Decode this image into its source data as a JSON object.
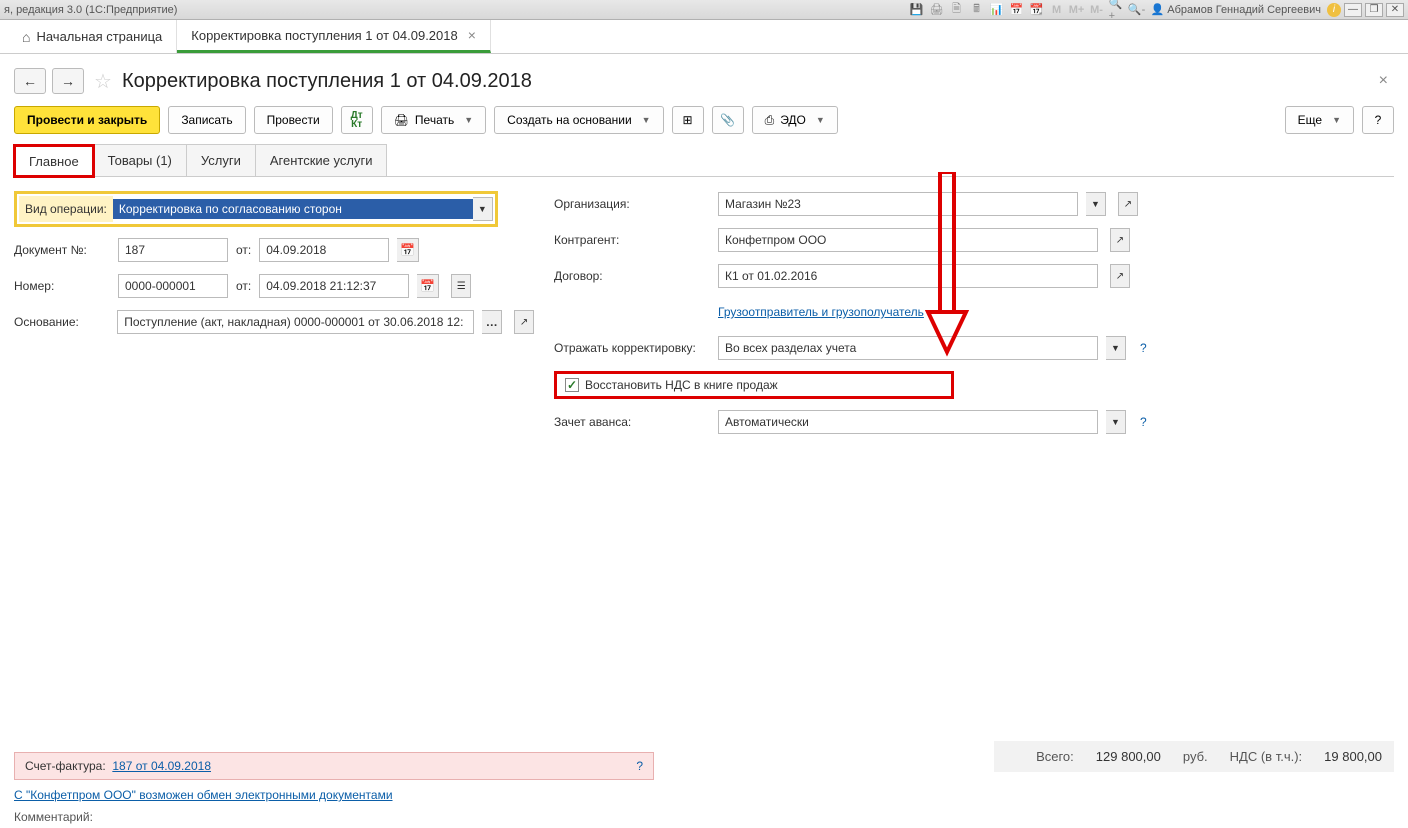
{
  "titlebar": {
    "app_title": "я, редакция 3.0  (1С:Предприятие)",
    "user_name": "Абрамов Геннадий Сергеевич"
  },
  "navtabs": {
    "home": "Начальная страница",
    "doc": "Корректировка поступления 1 от 04.09.2018"
  },
  "page_title": "Корректировка поступления 1 от 04.09.2018",
  "toolbar": {
    "post_close": "Провести и закрыть",
    "save": "Записать",
    "post": "Провести",
    "print": "Печать",
    "create_based": "Создать на основании",
    "edo": "ЭДО",
    "more": "Еще"
  },
  "doctabs": {
    "main": "Главное",
    "goods": "Товары (1)",
    "services": "Услуги",
    "agent": "Агентские услуги"
  },
  "form": {
    "operation_type_label": "Вид операции:",
    "operation_type_value": "Корректировка по согласованию сторон",
    "doc_no_label": "Документ №:",
    "doc_no_value": "187",
    "doc_from": "от:",
    "doc_date": "04.09.2018",
    "number_label": "Номер:",
    "number_value": "0000-000001",
    "number_datetime": "04.09.2018 21:12:37",
    "basis_label": "Основание:",
    "basis_value": "Поступление (акт, накладная) 0000-000001 от 30.06.2018 12:",
    "org_label": "Организация:",
    "org_value": "Магазин №23",
    "contragent_label": "Контрагент:",
    "contragent_value": "Конфетпром ООО",
    "contract_label": "Договор:",
    "contract_value": "К1 от 01.02.2016",
    "shipper_link": "Грузоотправитель и грузополучатель",
    "reflect_label": "Отражать корректировку:",
    "reflect_value": "Во всех разделах учета",
    "restore_nds": "Восстановить НДС в книге продаж",
    "advance_label": "Зачет аванса:",
    "advance_value": "Автоматически"
  },
  "footer": {
    "invoice_label": "Счет-фактура:",
    "invoice_link": "187 от 04.09.2018",
    "edo_note": "С \"Конфетпром ООО\" возможен обмен электронными документами",
    "comment_label": "Комментарий:",
    "total_label": "Всего:",
    "total_value": "129 800,00",
    "currency": "руб.",
    "nds_label": "НДС (в т.ч.):",
    "nds_value": "19 800,00"
  }
}
